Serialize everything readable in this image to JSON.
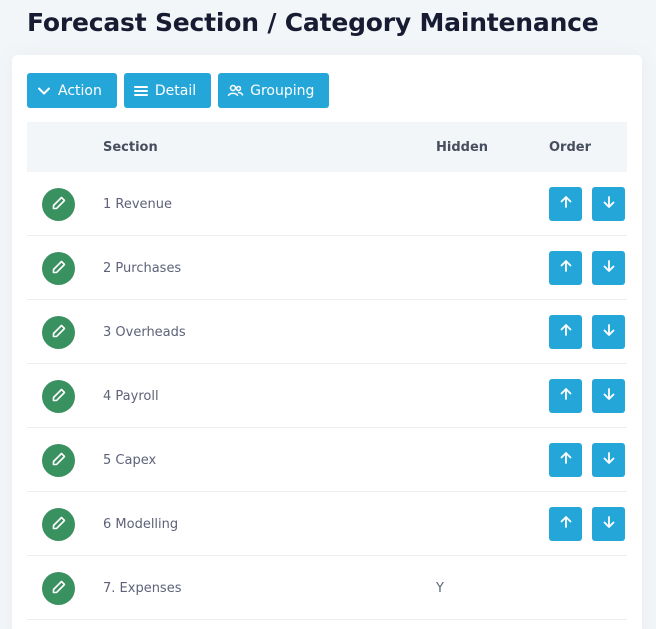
{
  "page": {
    "title": "Forecast Section / Category Maintenance"
  },
  "toolbar": {
    "action_label": "Action",
    "detail_label": "Detail",
    "grouping_label": "Grouping"
  },
  "table": {
    "headers": {
      "section": "Section",
      "hidden": "Hidden",
      "order": "Order"
    },
    "rows": [
      {
        "section": "1 Revenue",
        "hidden": "",
        "orderable": true
      },
      {
        "section": "2 Purchases",
        "hidden": "",
        "orderable": true
      },
      {
        "section": "3 Overheads",
        "hidden": "",
        "orderable": true
      },
      {
        "section": "4 Payroll",
        "hidden": "",
        "orderable": true
      },
      {
        "section": "5 Capex",
        "hidden": "",
        "orderable": true
      },
      {
        "section": "6 Modelling",
        "hidden": "",
        "orderable": true
      },
      {
        "section": "7. Expenses",
        "hidden": "Y",
        "orderable": false
      }
    ]
  },
  "icons": {
    "action": "chevron-down-icon",
    "detail": "list-icon",
    "grouping": "users-icon",
    "edit": "pencil-icon",
    "up": "arrow-up-icon",
    "down": "arrow-down-icon"
  },
  "colors": {
    "accent": "#25a6d9",
    "edit": "#3a9160",
    "background": "#f3f6f9"
  }
}
